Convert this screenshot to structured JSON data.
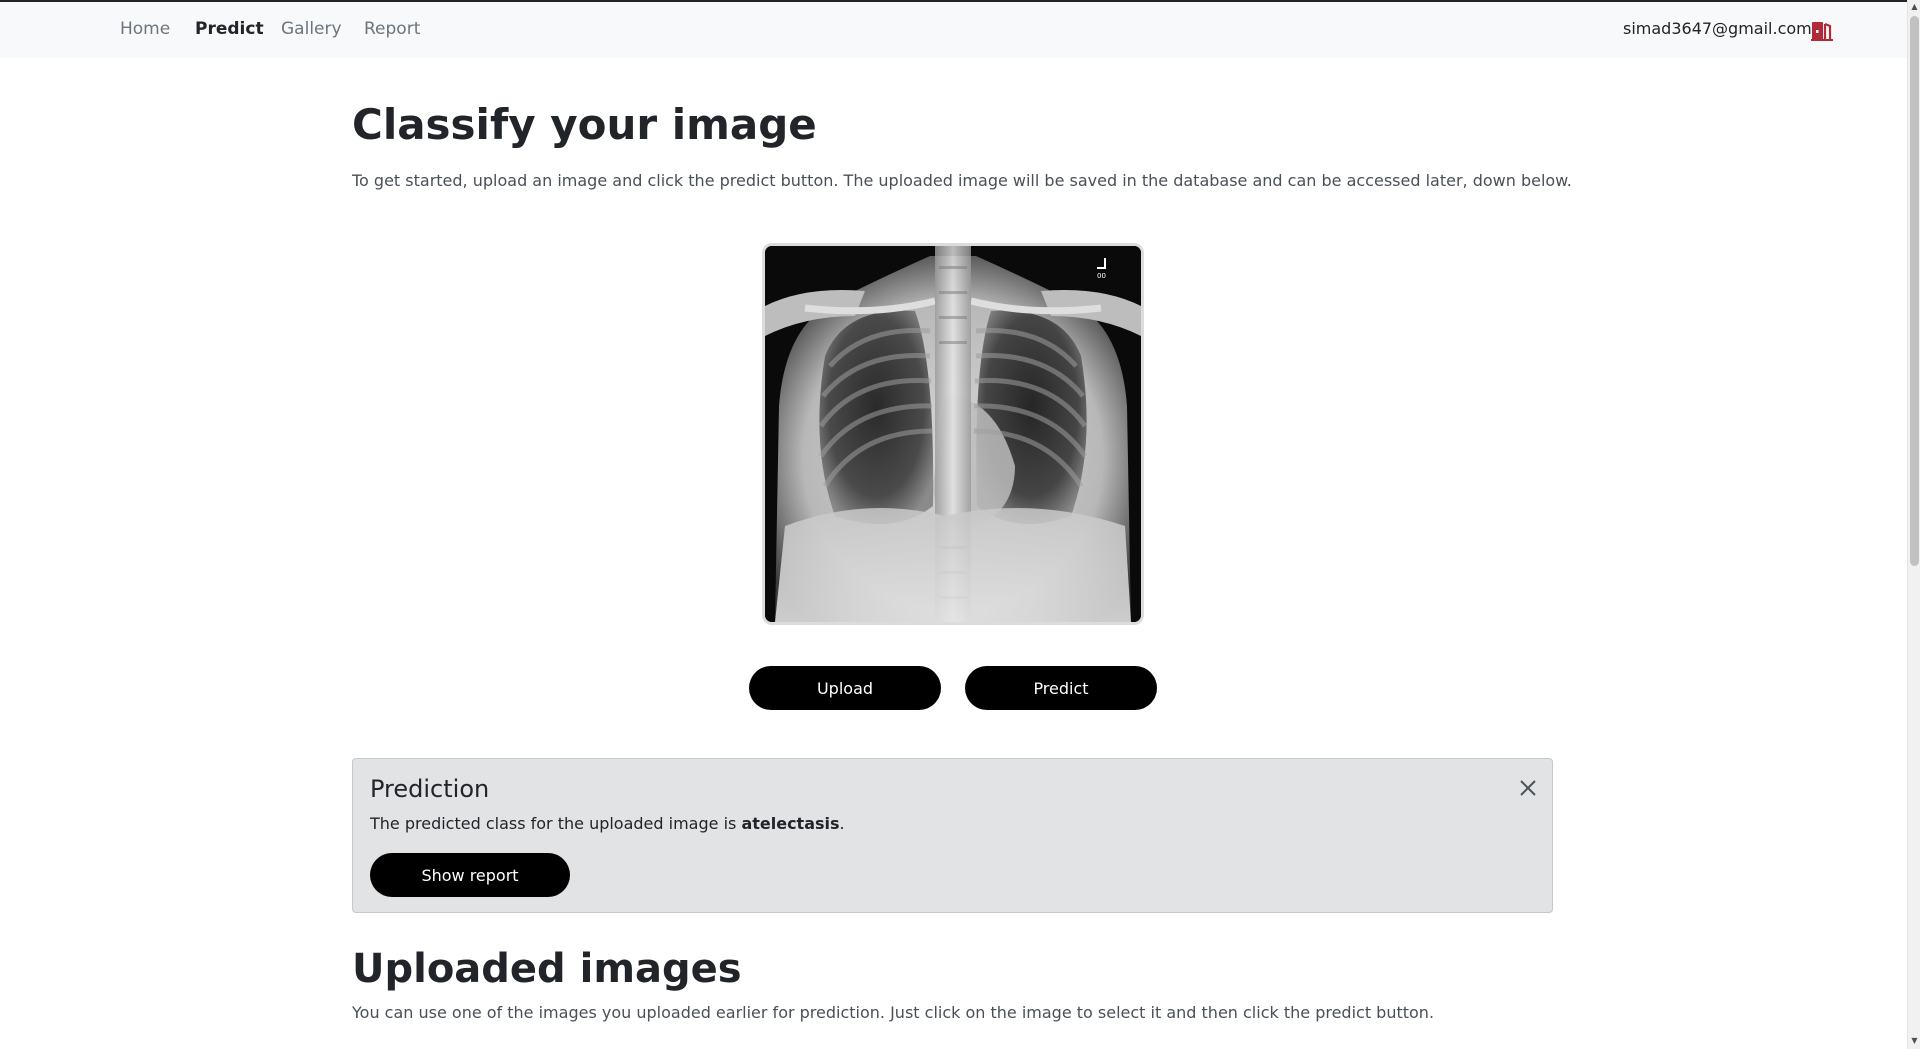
{
  "nav": {
    "links": [
      {
        "label": "Home"
      },
      {
        "label": "Predict"
      },
      {
        "label": "Gallery"
      },
      {
        "label": "Report"
      }
    ],
    "active": "Predict",
    "user_email": "simad3647@gmail.com",
    "logout_icon": "door-exit-icon",
    "logout_color": "#b02a37"
  },
  "main": {
    "title": "Classify your image",
    "description": "To get started, upload an image and click the predict button. The uploaded image will be saved in the database and can be accessed later, down below.",
    "image_alt": "chest x-ray",
    "upload_label": "Upload",
    "predict_label": "Predict"
  },
  "prediction": {
    "title": "Prediction",
    "text_prefix": "The predicted class for the uploaded image is ",
    "class_name": "atelectasis",
    "text_suffix": ".",
    "show_report_label": "Show report",
    "close_icon": "close-icon"
  },
  "uploaded": {
    "title": "Uploaded images",
    "description": "You can use one of the images you uploaded earlier for prediction. Just click on the image to select it and then click the predict button."
  },
  "colors": {
    "button_bg": "#000000",
    "alert_bg": "#e2e3e5",
    "navbar_bg": "#f8f9fa"
  }
}
